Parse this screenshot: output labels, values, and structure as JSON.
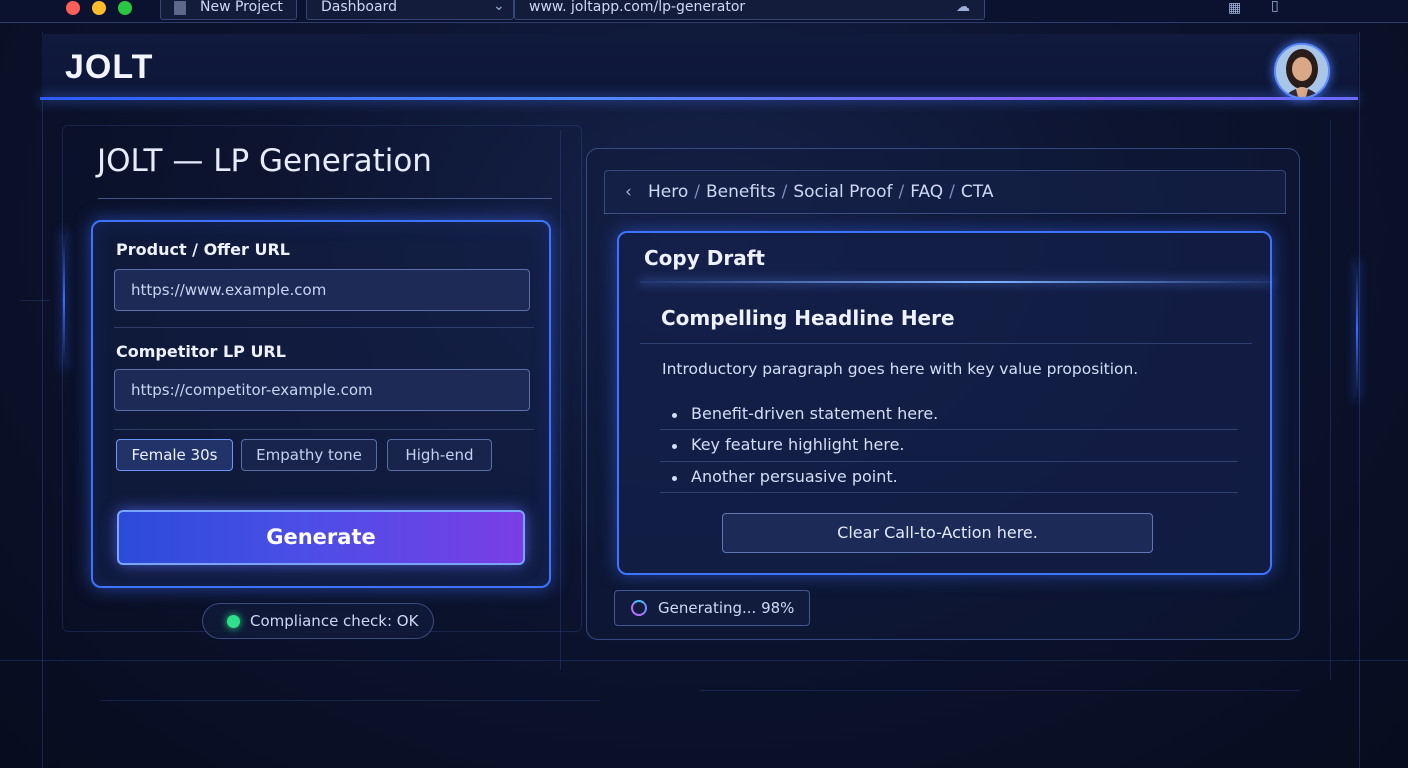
{
  "browser": {
    "tab_label": "New Project",
    "nav_select": "Dashboard",
    "address": "www. joltapp.com/lp-generator"
  },
  "header": {
    "logo": "JOLT",
    "avatar_icon": "user-avatar"
  },
  "left": {
    "title": "JOLT — LP Generation",
    "product_label": "Product / Offer URL",
    "product_value": "https://www.example.com",
    "competitor_label": "Competitor LP URL",
    "competitor_value": "https://competitor-example.com",
    "chips": [
      "Female 30s",
      "Empathy tone",
      "High-end"
    ],
    "generate_label": "Generate",
    "compliance_text": "Compliance check: OK"
  },
  "right": {
    "breadcrumb": [
      "Hero",
      "Benefits",
      "Social Proof",
      "FAQ",
      "CTA"
    ],
    "draft_title": "Copy Draft",
    "headline": "Compelling Headline Here",
    "intro": "Introductory paragraph goes here with key value proposition.",
    "bullets": [
      "Benefit-driven statement here.",
      "Key feature highlight here.",
      "Another persuasive point."
    ],
    "cta_label": "Clear Call-to-Action here.",
    "status_text": "Generating... 98%"
  },
  "colors": {
    "accent": "#3d74ff",
    "accent_purple": "#7a3ee6",
    "ok_green": "#2ee08a"
  }
}
